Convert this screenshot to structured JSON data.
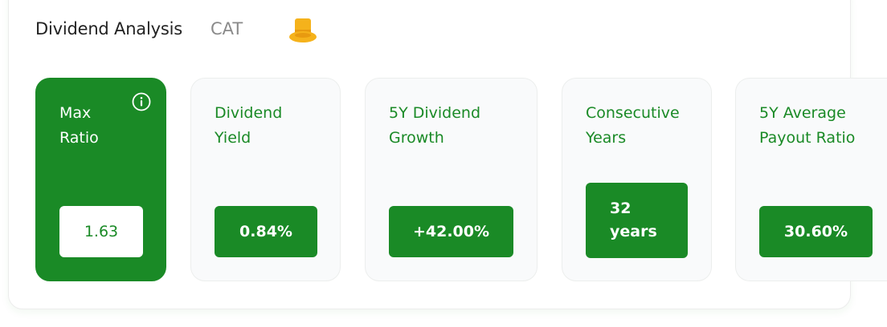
{
  "header": {
    "title": "Dividend Analysis",
    "ticker": "CAT",
    "hat_icon": "top-hat-icon"
  },
  "colors": {
    "accent_green": "#1a8a26",
    "card_bg": "#f9fafb"
  },
  "cards": [
    {
      "label": "Max\nRatio",
      "value": "1.63",
      "active": true,
      "icon": "info-icon"
    },
    {
      "label": "Dividend\nYield",
      "value": "0.84%"
    },
    {
      "label": "5Y Dividend\nGrowth",
      "value": "+42.00%"
    },
    {
      "label": "Consecutive\nYears",
      "value": "32\nyears"
    },
    {
      "label": "5Y Average\nPayout Ratio",
      "value": "30.60%"
    }
  ]
}
